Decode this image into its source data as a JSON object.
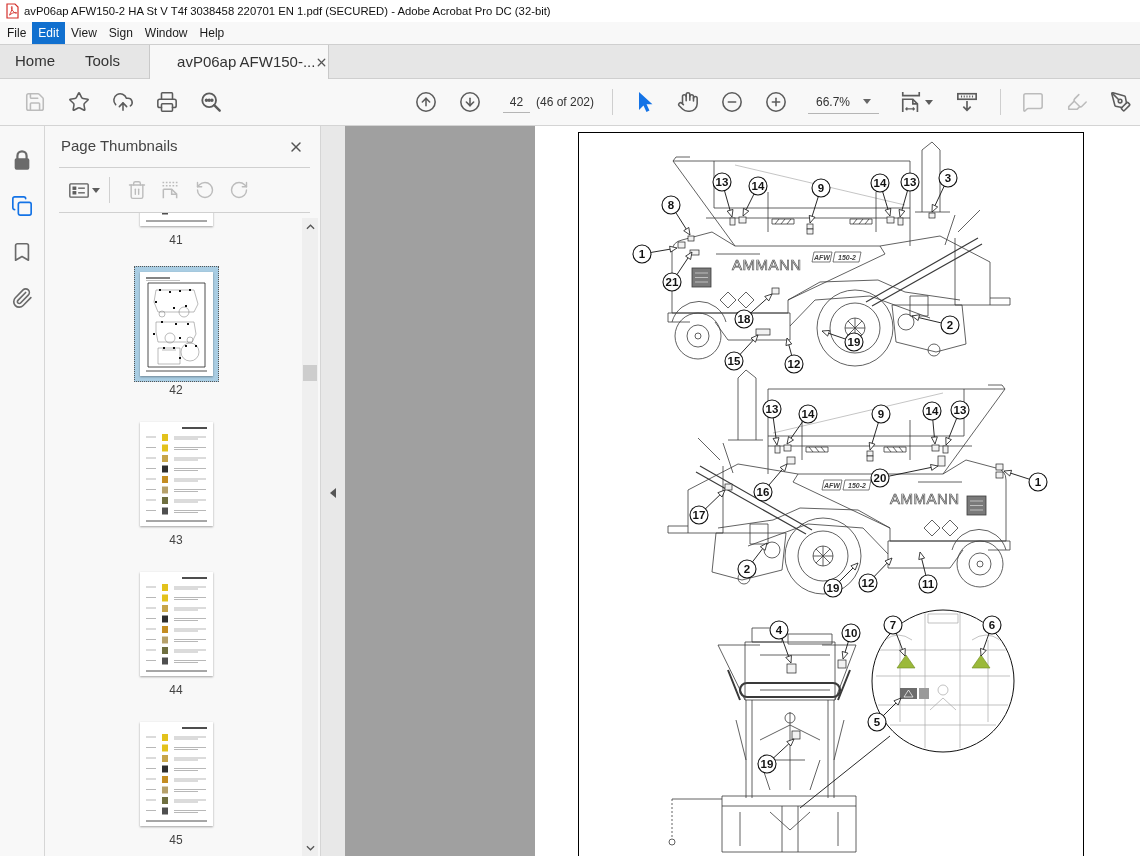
{
  "window": {
    "title": "avP06ap AFW150-2 HA St V T4f 3038458 220701 EN 1.pdf (SECURED) - Adobe Acrobat Pro DC (32-bit)"
  },
  "menu": [
    {
      "label": "File",
      "selected": false
    },
    {
      "label": "Edit",
      "selected": true
    },
    {
      "label": "View",
      "selected": false
    },
    {
      "label": "Sign",
      "selected": false
    },
    {
      "label": "Window",
      "selected": false
    },
    {
      "label": "Help",
      "selected": false
    }
  ],
  "tabs": [
    {
      "label": "Home",
      "kind": "nav",
      "selected": false
    },
    {
      "label": "Tools",
      "kind": "nav",
      "selected": false
    },
    {
      "label": "avP06ap AFW150-...",
      "kind": "document",
      "selected": true
    }
  ],
  "toolbar": {
    "file_tools": [
      {
        "kind": "save",
        "disabled": true
      },
      {
        "kind": "bookmark",
        "disabled": false
      },
      {
        "kind": "upload",
        "disabled": false
      },
      {
        "kind": "print",
        "disabled": false
      },
      {
        "kind": "find",
        "disabled": false
      }
    ],
    "page_nav": [
      {
        "kind": "up"
      },
      {
        "kind": "down"
      }
    ],
    "page_field": {
      "value": "42"
    },
    "page_count": "(46 of 202)",
    "pointer_tools": [
      {
        "kind": "select",
        "selected": true
      },
      {
        "kind": "hand",
        "selected": false
      }
    ],
    "zoom_tools": [
      {
        "kind": "zoom_out"
      },
      {
        "kind": "zoom_in"
      }
    ],
    "zoom_field": {
      "value": "66.7%"
    },
    "view_tools": [
      {
        "kind": "fit_page",
        "has_menu": true
      },
      {
        "kind": "scroll_mode"
      }
    ],
    "annotate_tools": [
      {
        "kind": "comment",
        "disabled": true
      },
      {
        "kind": "highlight",
        "disabled": true
      },
      {
        "kind": "sign",
        "disabled": false
      }
    ]
  },
  "nav_rail": [
    {
      "kind": "lock",
      "selected": false
    },
    {
      "kind": "pages",
      "selected": true
    },
    {
      "kind": "bookmarks",
      "selected": false
    },
    {
      "kind": "attachments",
      "selected": false
    }
  ],
  "thumbnails_panel": {
    "title": "Page Thumbnails",
    "tools": [
      {
        "kind": "options",
        "has_menu": true,
        "disabled": false
      },
      {
        "kind": "delete",
        "disabled": true
      },
      {
        "kind": "extract",
        "disabled": true
      },
      {
        "kind": "rotate_left",
        "disabled": true
      },
      {
        "kind": "rotate_right",
        "disabled": true
      }
    ],
    "thumbnails": [
      {
        "label": "41",
        "kind": "table",
        "selected": false
      },
      {
        "label": "42",
        "kind": "drawing",
        "selected": true
      },
      {
        "label": "43",
        "kind": "table",
        "selected": false
      },
      {
        "label": "44",
        "kind": "table",
        "selected": false
      },
      {
        "label": "45",
        "kind": "table",
        "selected": false
      }
    ]
  },
  "document": {
    "views": [
      {
        "kind": "side",
        "brand": "AMMANN",
        "model": [
          "AFW",
          "150-2"
        ],
        "callouts": [
          "13",
          "14",
          "9",
          "14",
          "13",
          "3",
          "8",
          "1",
          "21",
          "18",
          "2",
          "19",
          "15",
          "12"
        ]
      },
      {
        "kind": "side_mirrored",
        "brand": "AMMANN",
        "model": [
          "AFW",
          "150-2"
        ],
        "callouts": [
          "13",
          "14",
          "9",
          "14",
          "13",
          "16",
          "20",
          "1",
          "17",
          "2",
          "19",
          "12",
          "11"
        ]
      },
      {
        "kind": "front",
        "callouts": [
          "4",
          "10",
          "19",
          "7",
          "6",
          "5"
        ]
      }
    ]
  }
}
